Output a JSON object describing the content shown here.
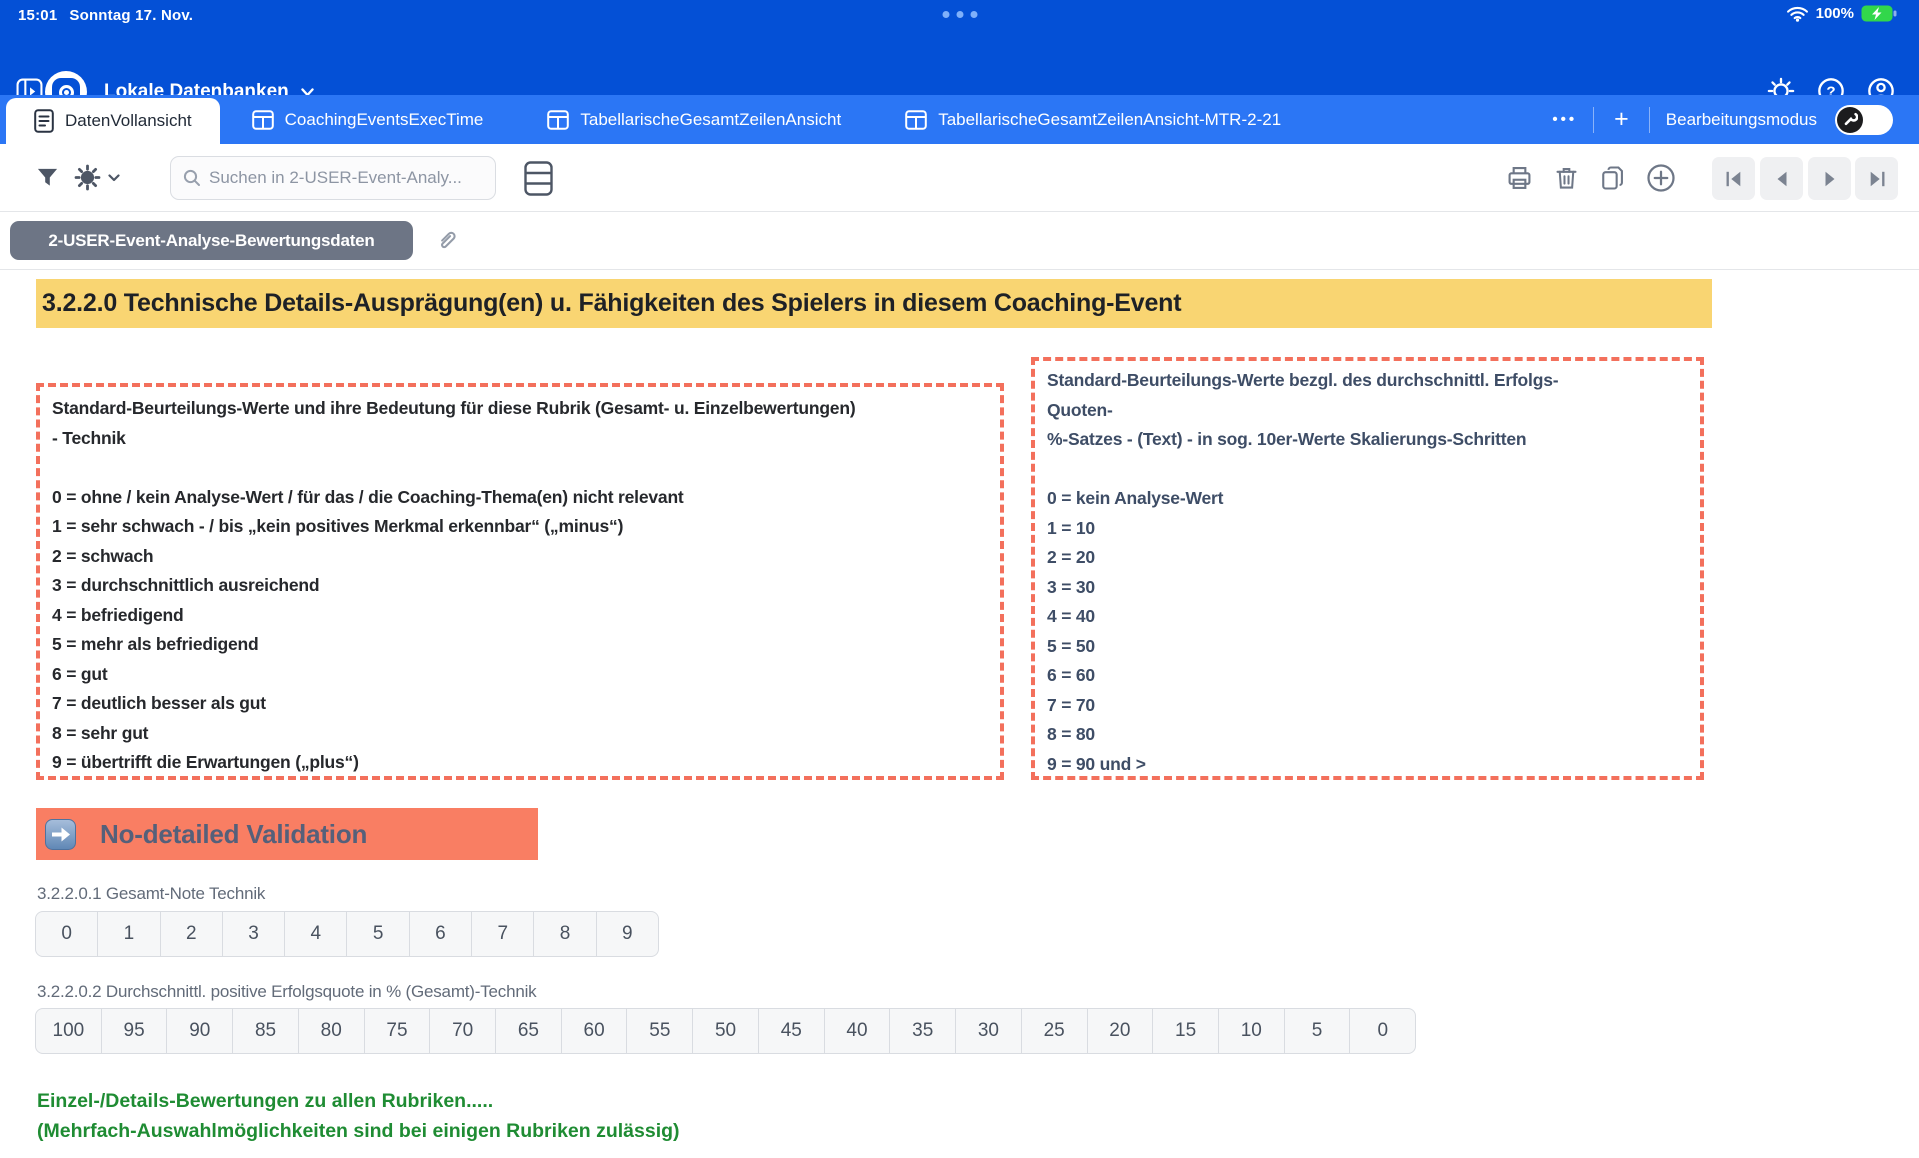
{
  "status_bar": {
    "time": "15:01",
    "date": "Sonntag 17. Nov.",
    "battery_percent": "100%"
  },
  "app_bar": {
    "workspace_label": "Lokale Datenbanken"
  },
  "tab_bar": {
    "tabs": [
      {
        "label": "DatenVollansicht"
      },
      {
        "label": "CoachingEventsExecTime"
      },
      {
        "label": "TabellarischeGesamtZeilenAnsicht"
      },
      {
        "label": "TabellarischeGesamtZeilenAnsicht-MTR-2-21"
      }
    ],
    "overflow_label": "•••",
    "add_label": "+",
    "edit_mode_label": "Bearbeitungsmodus"
  },
  "toolbar": {
    "search_placeholder": "Suchen in 2-USER-Event-Analy..."
  },
  "record_bar": {
    "table_button_label": "2-USER-Event-Analyse-Bewertungsdaten"
  },
  "content": {
    "section_header": "3.2.2.0  Technische Details-Ausprägung(en) u. Fähigkeiten des Spielers in diesem Coaching-Event",
    "left_box": {
      "lines": [
        "Standard-Beurteilungs-Werte und ihre Bedeutung für diese Rubrik (Gesamt- u. Einzelbewertungen)",
        "- Technik",
        "",
        "0 = ohne / kein Analyse-Wert / für das / die Coaching-Thema(en) nicht relevant",
        "1 = sehr schwach - / bis „kein positives Merkmal erkennbar“ („minus“)",
        "2 = schwach",
        "3 = durchschnittlich ausreichend",
        "4 = befriedigend",
        "5 = mehr als befriedigend",
        "6 = gut",
        "7 = deutlich besser als gut",
        "8 = sehr gut",
        "9 = übertrifft die Erwartungen („plus“)"
      ]
    },
    "right_box": {
      "lines": [
        "Standard-Beurteilungs-Werte bezgl. des durchschnittl. Erfolgs-",
        "Quoten-",
        "%-Satzes - (Text) - in sog. 10er-Werte Skalierungs-Schritten",
        "",
        "0 = kein Analyse-Wert",
        "1 = 10",
        "2 = 20",
        "3 = 30",
        "4 = 40",
        "5 = 50",
        "6 = 60",
        "7 = 70",
        "8 = 80",
        "9 = 90 und >"
      ]
    },
    "validation_button_label": "No-detailed Validation",
    "fields": [
      {
        "label": "3.2.2.0.1 Gesamt-Note Technik",
        "options": [
          "0",
          "1",
          "2",
          "3",
          "4",
          "5",
          "6",
          "7",
          "8",
          "9"
        ]
      },
      {
        "label": "3.2.2.0.2 Durchschnittl. positive Erfolgsquote in % (Gesamt)-Technik",
        "options": [
          "100",
          "95",
          "90",
          "85",
          "80",
          "75",
          "70",
          "65",
          "60",
          "55",
          "50",
          "45",
          "40",
          "35",
          "30",
          "25",
          "20",
          "15",
          "10",
          "5",
          "0"
        ]
      }
    ],
    "footer_lines": [
      "Einzel-/Details-Bewertungen zu allen Rubriken.....",
      "(Mehrfach-Auswahlmöglichkeiten sind bei einigen Rubriken zulässig)"
    ]
  },
  "colors": {
    "app_blue": "#0450d6",
    "tab_blue": "#2b76f5",
    "header_yellow": "#f9d572",
    "dashed_coral": "#f3705c",
    "button_coral": "#f97e63",
    "record_gray": "#6d7585",
    "footer_green": "#1f8c33",
    "battery_green": "#32d74b"
  }
}
